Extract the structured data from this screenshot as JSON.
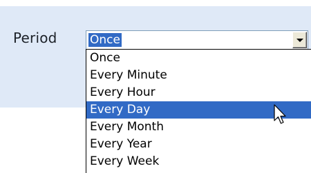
{
  "form": {
    "period_label": "Period",
    "period_value": "Once"
  },
  "dropdown": {
    "options": [
      {
        "label": "Once",
        "selected": false
      },
      {
        "label": "Every Minute",
        "selected": false
      },
      {
        "label": "Every Hour",
        "selected": false
      },
      {
        "label": "Every Day",
        "selected": true
      },
      {
        "label": "Every Month",
        "selected": false
      },
      {
        "label": "Every Year",
        "selected": false
      },
      {
        "label": "Every Week",
        "selected": false
      }
    ],
    "highlight_color": "#316ac5"
  },
  "icons": {
    "dropdown_button": "chevron-down-icon",
    "pointer": "mouse-pointer-icon"
  },
  "colors": {
    "panel_background": "#dfe9f7",
    "input_border": "#7f9db9"
  }
}
